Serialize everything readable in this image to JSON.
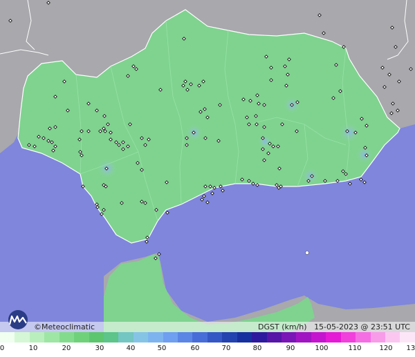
{
  "brand": "©Meteoclimatic",
  "caption": {
    "variable": "DGST (km/h)",
    "datetime": "15-05-2023 @ 23:51 UTC"
  },
  "legend": {
    "ticks": [
      "0",
      "10",
      "20",
      "30",
      "40",
      "50",
      "60",
      "70",
      "80",
      "90",
      "100",
      "110",
      "120",
      "130"
    ],
    "colors": [
      "#f0fff0",
      "#d5f7d5",
      "#b9efbd",
      "#9ee6a4",
      "#83dc8e",
      "#6fd27b",
      "#5cc66f",
      "#5dc48a",
      "#74c6c2",
      "#86c4e6",
      "#7db4ef",
      "#6f9ff0",
      "#5b86e6",
      "#476ed8",
      "#3557c6",
      "#2343b0",
      "#1730a0",
      "#2e1a9e",
      "#5716a8",
      "#7a16b8",
      "#a114c4",
      "#c514cf",
      "#e51ad6",
      "#f140dc",
      "#f56ee3",
      "#f89ce9",
      "#fbc7f1",
      "#fde5f8"
    ],
    "tick_fractions": [
      0.005,
      0.08,
      0.16,
      0.24,
      0.315,
      0.39,
      0.47,
      0.545,
      0.62,
      0.7,
      0.775,
      0.855,
      0.93,
      0.995
    ]
  },
  "map_colors": {
    "sea": "#7f86dc",
    "land_region": "#7fd38f",
    "land_outside": "#a9a9ad",
    "border": "#ffffff",
    "station": "#111111"
  }
}
